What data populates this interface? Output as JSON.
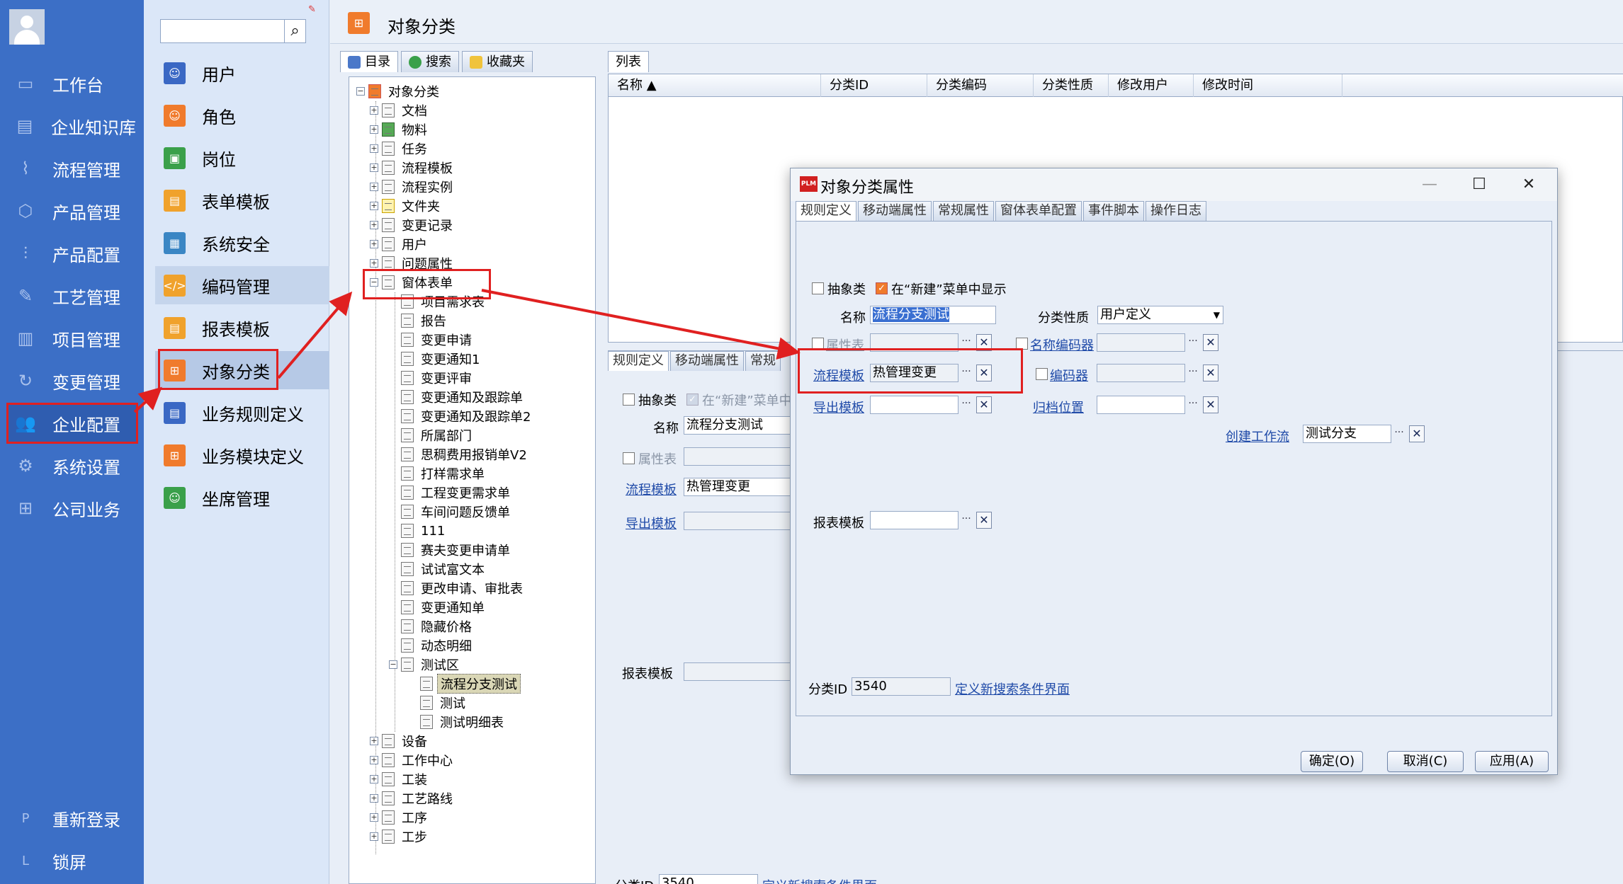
{
  "nav": {
    "items": [
      {
        "label": "工作台",
        "icon": "monitor-icon"
      },
      {
        "label": "企业知识库",
        "icon": "book-icon"
      },
      {
        "label": "流程管理",
        "icon": "flow-icon"
      },
      {
        "label": "产品管理",
        "icon": "cube-icon"
      },
      {
        "label": "产品配置",
        "icon": "sliders-icon"
      },
      {
        "label": "工艺管理",
        "icon": "wrench-icon"
      },
      {
        "label": "项目管理",
        "icon": "chart-icon"
      },
      {
        "label": "变更管理",
        "icon": "refresh-icon"
      },
      {
        "label": "企业配置",
        "icon": "users-icon"
      },
      {
        "label": "系统设置",
        "icon": "gear-icon"
      },
      {
        "label": "公司业务",
        "icon": "grid-icon"
      }
    ],
    "relogin": {
      "key": "P",
      "label": "重新登录"
    },
    "lock": {
      "key": "L",
      "label": "锁屏"
    },
    "active_color": "#e02020"
  },
  "submenu": {
    "search_placeholder": "",
    "items": [
      {
        "label": "用户",
        "color": "#3a68c4"
      },
      {
        "label": "角色",
        "color": "#f07b2c"
      },
      {
        "label": "岗位",
        "color": "#3aa04a"
      },
      {
        "label": "表单模板",
        "color": "#f0a22c"
      },
      {
        "label": "系统安全",
        "color": "#3a86c4"
      },
      {
        "label": "编码管理",
        "color": "#f0a22c"
      },
      {
        "label": "报表模板",
        "color": "#f0a22c"
      },
      {
        "label": "对象分类",
        "color": "#f07b2c"
      },
      {
        "label": "业务规则定义",
        "color": "#3a68c4"
      },
      {
        "label": "业务模块定义",
        "color": "#f07b2c"
      },
      {
        "label": "坐席管理",
        "color": "#3aa04a"
      }
    ]
  },
  "main": {
    "title": "对象分类",
    "left_tabs": [
      "目录",
      "搜索",
      "收藏夹"
    ],
    "right_tabs": [
      "列表"
    ],
    "tree": {
      "root": "对象分类",
      "top": [
        "文档",
        "物料",
        "任务",
        "流程模板",
        "流程实例",
        "文件夹",
        "变更记录",
        "用户",
        "问题属性"
      ],
      "form_node": "窗体表单",
      "forms": [
        "项目需求表",
        "报告",
        "变更申请",
        "变更通知1",
        "变更评审",
        "变更通知及跟踪单",
        "变更通知及跟踪单2",
        "所属部门",
        "思稠费用报销单V2",
        "打样需求单",
        "工程变更需求单",
        "车间问题反馈单",
        "111",
        "赛夫变更申请单",
        "试试富文本",
        "更改申请、审批表",
        "变更通知单",
        "隐藏价格",
        "动态明细"
      ],
      "test_node": "测试区",
      "test_children": [
        "流程分支测试",
        "测试",
        "测试明细表"
      ],
      "bottom": [
        "设备",
        "工作中心",
        "工装",
        "工艺路线",
        "工序",
        "工步"
      ]
    },
    "list_columns": [
      "名称 ▲",
      "分类ID",
      "分类编码",
      "分类性质",
      "修改用户",
      "修改时间"
    ]
  },
  "bgform": {
    "tabs": [
      "规则定义",
      "移动端属性",
      "常规"
    ],
    "abstract_label": "抽象类",
    "show_label": "在“新建”菜单中显示",
    "name_label": "名称",
    "name_value": "流程分支测试",
    "attr_table_label": "属性表",
    "flow_template_label": "流程模板",
    "flow_template_value": "热管理变更",
    "export_template_label": "导出模板",
    "report_template_label": "报表模板",
    "class_id_label": "分类ID",
    "class_id_value": "3540",
    "define_search_label": "定义新搜索条件界面"
  },
  "dialog": {
    "app_badge": "PLM",
    "title": "对象分类属性",
    "tabs": [
      "规则定义",
      "移动端属性",
      "常规属性",
      "窗体表单配置",
      "事件脚本",
      "操作日志"
    ],
    "abstract_label": "抽象类",
    "show_in_new_label": "在“新建”菜单中显示",
    "name_label": "名称",
    "name_value": "流程分支测试",
    "nature_label": "分类性质",
    "nature_value": "用户定义",
    "attr_table_label": "属性表",
    "name_encoder_label": "名称编码器",
    "flow_template_label": "流程模板",
    "flow_template_value": "热管理变更",
    "encoder_label": "编码器",
    "export_template_label": "导出模板",
    "archive_label": "归档位置",
    "create_workflow_label": "创建工作流",
    "create_workflow_value": "测试分支",
    "report_template_label": "报表模板",
    "class_id_label": "分类ID",
    "class_id_value": "3540",
    "define_search_label": "定义新搜索条件界面",
    "ok_label": "确定(O)",
    "cancel_label": "取消(C)",
    "apply_label": "应用(A)",
    "dots": "···",
    "clear": "✕"
  }
}
